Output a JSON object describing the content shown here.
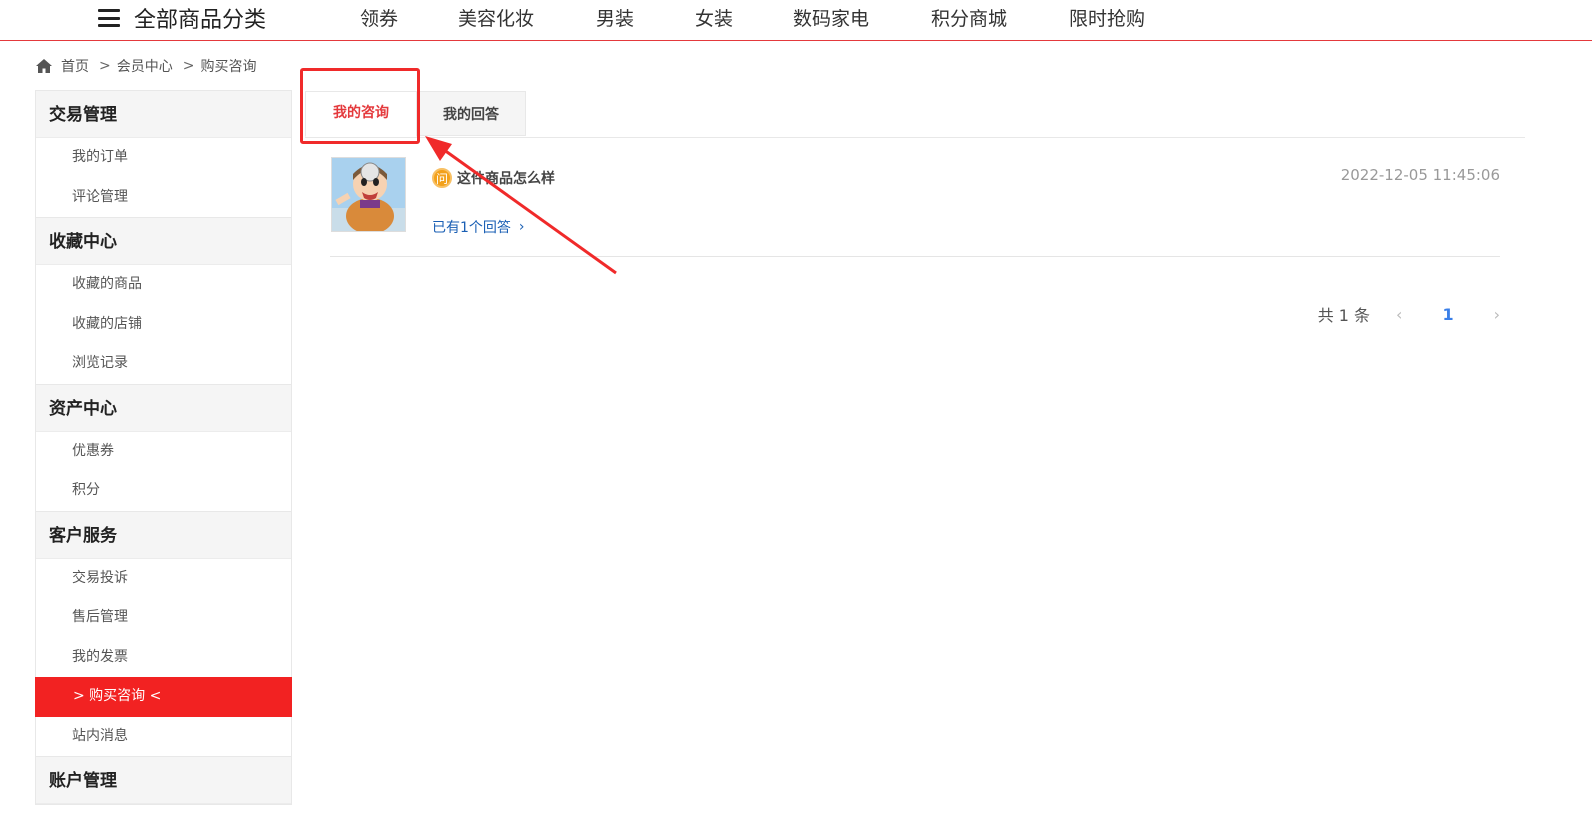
{
  "topnav": {
    "all_categories": "全部商品分类",
    "items": [
      "领券",
      "美容化妆",
      "男装",
      "女装",
      "数码家电",
      "积分商城",
      "限时抢购"
    ]
  },
  "breadcrumb": {
    "home": "首页",
    "sep": ">",
    "member": "会员中心",
    "current": "购买咨询"
  },
  "sidebar": {
    "groups": [
      {
        "title": "交易管理",
        "items": [
          "我的订单",
          "评论管理"
        ]
      },
      {
        "title": "收藏中心",
        "items": [
          "收藏的商品",
          "收藏的店铺",
          "浏览记录"
        ]
      },
      {
        "title": "资产中心",
        "items": [
          "优惠券",
          "积分"
        ]
      },
      {
        "title": "客户服务",
        "items": [
          "交易投诉",
          "售后管理",
          "我的发票",
          "> 购买咨询 <",
          "站内消息"
        ]
      },
      {
        "title": "账户管理",
        "items": []
      }
    ]
  },
  "tabs": {
    "my_questions": "我的咨询",
    "my_answers": "我的回答"
  },
  "question": {
    "badge": "问",
    "title": "这件商品怎么样",
    "time": "2022-12-05 11:45:06",
    "answers": "已有1个回答",
    "answers_chevron": "›"
  },
  "pagination": {
    "total": "共 1 条",
    "prev": "‹",
    "page": "1",
    "next": "›"
  },
  "colors": {
    "accent": "#e4393c",
    "active_sidebar": "#f22222",
    "link": "#1a5fb4",
    "badge": "#f3a11b",
    "annotation": "#f02a2a"
  }
}
